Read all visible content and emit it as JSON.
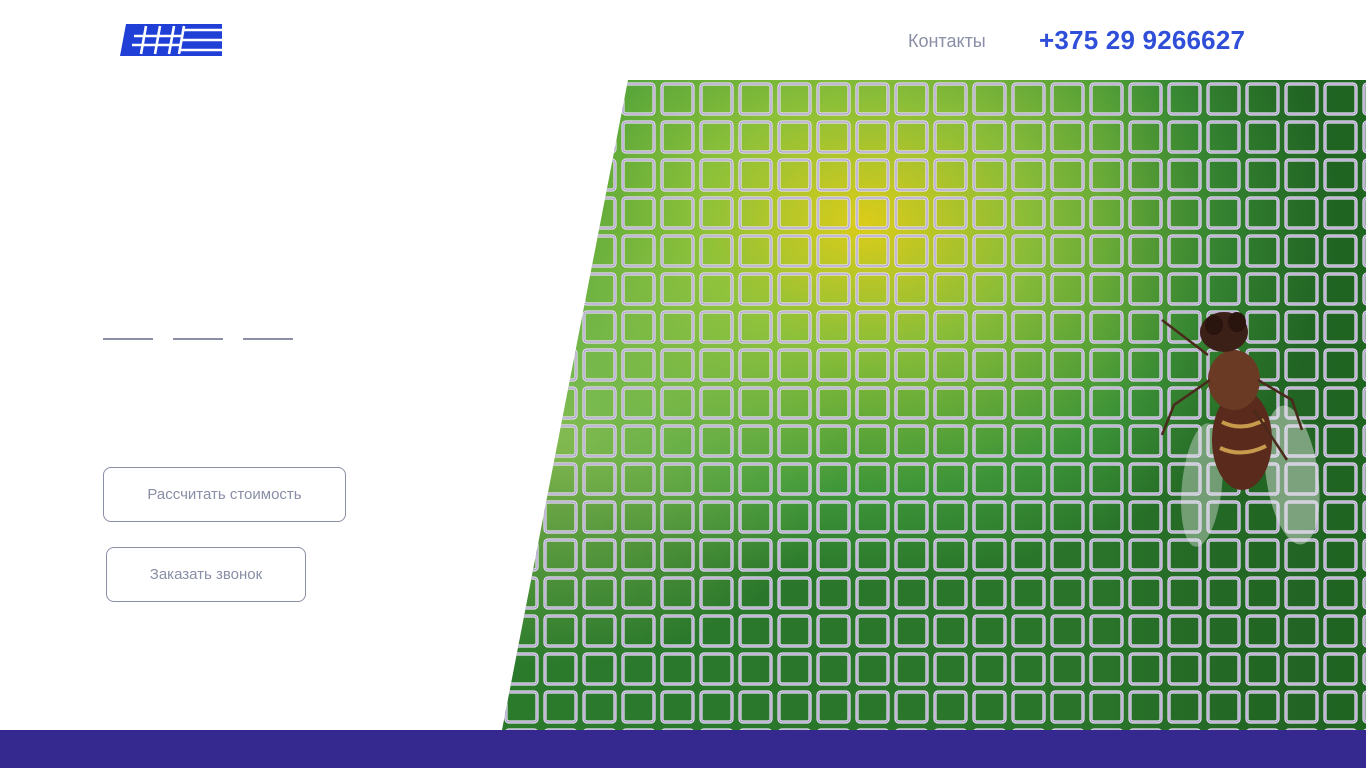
{
  "header": {
    "logo_icon": "window-grid-logo",
    "nav_contacts_label": "Контакты",
    "phone": "+375 29 9266627",
    "brand_color": "#2f4fd8"
  },
  "hero": {
    "image": "mosquito-net-with-fly",
    "slider_count": 3,
    "buttons": {
      "calc_label": "Рассчитать стоимость",
      "call_label": "Заказать звонок"
    }
  },
  "footer": {
    "band_color": "#35298f"
  }
}
